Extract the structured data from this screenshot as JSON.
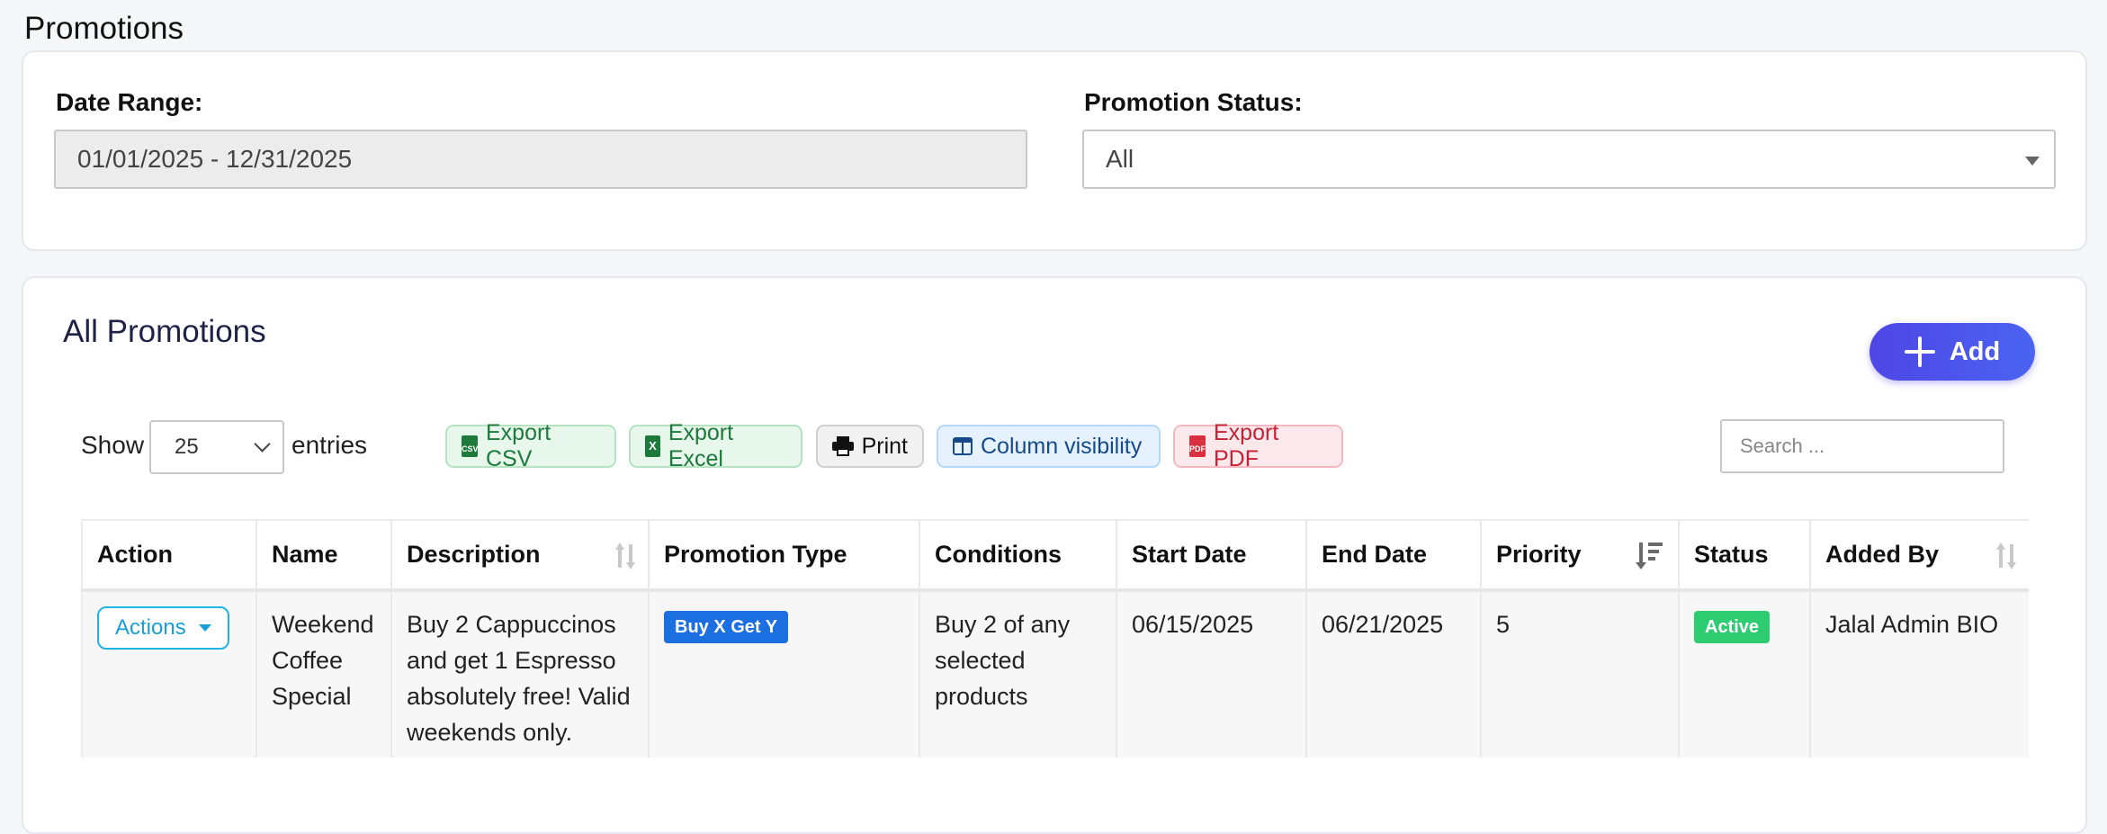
{
  "page": {
    "title": "Promotions"
  },
  "filters": {
    "date_range_label": "Date Range:",
    "date_range_value": "01/01/2025 - 12/31/2025",
    "status_label": "Promotion Status:",
    "status_value": "All"
  },
  "promotions": {
    "title": "All Promotions",
    "add_label": "Add",
    "show_label": "Show",
    "entries_value": "25",
    "entries_label": "entries",
    "search_placeholder": "Search ...",
    "toolbar": {
      "csv": "Export CSV",
      "excel": "Export Excel",
      "print": "Print",
      "colvis": "Column visibility",
      "pdf": "Export PDF"
    },
    "columns": [
      "Action",
      "Name",
      "Description",
      "Promotion Type",
      "Conditions",
      "Start Date",
      "End Date",
      "Priority",
      "Status",
      "Added By"
    ],
    "rows": [
      {
        "action": "Actions",
        "name": "Weekend Coffee Special",
        "description": "Buy 2 Cappuccinos and get 1 Espresso absolutely free! Valid weekends only.",
        "type": "Buy X Get Y",
        "conditions": "Buy 2 of any selected products",
        "start_date": "06/15/2025",
        "end_date": "06/21/2025",
        "priority": "5",
        "status": "Active",
        "added_by": "Jalal Admin BIO"
      }
    ]
  },
  "icons": {
    "csv": "csv-file-icon",
    "excel": "excel-file-icon",
    "print": "printer-icon",
    "colvis": "columns-icon",
    "pdf": "pdf-file-icon"
  }
}
